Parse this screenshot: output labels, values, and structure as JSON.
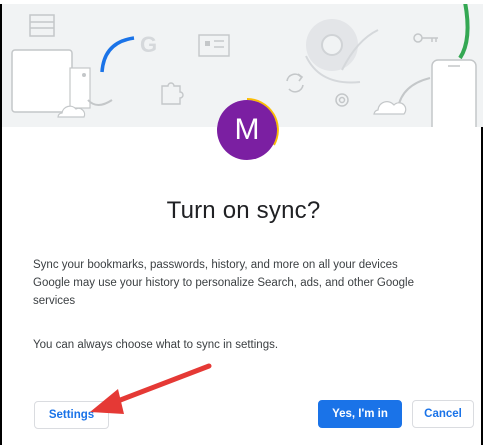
{
  "dialog": {
    "avatar_letter": "M",
    "title": "Turn on sync?",
    "description_lines": [
      "Sync your bookmarks, passwords, history, and more on all your devices",
      "Google may use your history to personalize Search, ads, and other Google services"
    ],
    "note": "You can always choose what to sync in settings.",
    "buttons": {
      "settings": "Settings",
      "yes": "Yes, I'm in",
      "cancel": "Cancel"
    }
  },
  "illustration": {
    "letter_g": "G",
    "icons": [
      "window-icon",
      "laptop-icon",
      "puzzle-icon",
      "sync-icon",
      "chrome-icon",
      "key-icon",
      "gear-icon",
      "phone-icon",
      "cloud-icon"
    ]
  },
  "colors": {
    "accent": "#1a73e8",
    "avatar": "#7b1fa2",
    "green": "#34a853",
    "illustration_bg": "#f1f3f4",
    "annotation_arrow": "#e53935"
  }
}
